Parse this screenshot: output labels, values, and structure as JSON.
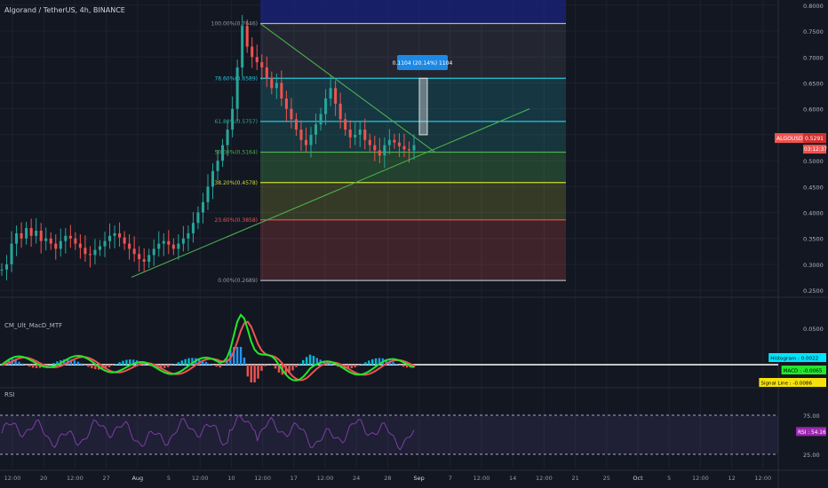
{
  "header": {
    "title": "Algorand / TetherUS, 4h, BINANCE"
  },
  "colors": {
    "bg": "#131722",
    "grid": "#1e2230",
    "up": "#26a69a",
    "down": "#ef5350",
    "trend": "#4caf50",
    "blue_band": "#1a237e",
    "badge": "#ef5350",
    "measure": "#1e88e5",
    "macd_line": "#21e82b",
    "signal_line": "#f5e20c",
    "rsi": "#7b3fa3",
    "zero_line": "#ffffff"
  },
  "chart_data": [
    {
      "type": "candlestick",
      "name": "main-price",
      "y_axis_ticks": [
        "0.8000",
        "0.7500",
        "0.7000",
        "0.6500",
        "0.6000",
        "0.5500",
        "0.5000",
        "0.4500",
        "0.4000",
        "0.3500",
        "0.3000",
        "0.2500"
      ],
      "ylim": [
        0.24,
        0.81
      ],
      "x_axis_ticks": [
        "12:00",
        "20",
        "12:00",
        "27",
        "Aug",
        "5",
        "12:00",
        "10",
        "12:00",
        "17",
        "12:00",
        "24",
        "28",
        "Sep",
        "7",
        "12:00",
        "14",
        "12:00",
        "21",
        "25",
        "Oct",
        "5",
        "12:00",
        "12",
        "12:00"
      ],
      "fib_levels": [
        {
          "label": "100.00%(0.7646)",
          "value": 0.7646,
          "line": "#b2b5be",
          "fill": "rgba(178,181,190,0.10)",
          "text": "#9598a1"
        },
        {
          "label": "78.60%(0.6589)",
          "value": 0.6589,
          "line": "#26c6da",
          "fill": "rgba(38,198,218,0.18)",
          "text": "#26c6da"
        },
        {
          "label": "61.80%(0.5757)",
          "value": 0.5757,
          "line": "#26c6da",
          "fill": "rgba(38,166,154,0.22)",
          "text": "#26a69a"
        },
        {
          "label": "50.00%(0.5164)",
          "value": 0.5164,
          "line": "#4caf50",
          "fill": "rgba(76,175,80,0.28)",
          "text": "#4caf50"
        },
        {
          "label": "38.20%(0.4578)",
          "value": 0.4578,
          "line": "#cddc39",
          "fill": "rgba(205,220,57,0.18)",
          "text": "#cddc39"
        },
        {
          "label": "23.60%(0.3858)",
          "value": 0.3858,
          "line": "#ef5350",
          "fill": "rgba(239,83,80,0.20)",
          "text": "#ef5350"
        },
        {
          "label": "0.00%(0.2689)",
          "value": 0.2689,
          "line": "#b2b5be",
          "fill": "",
          "text": "#9598a1"
        }
      ],
      "measure_label": "0.1104 (20.14%) 1104",
      "price_badge": {
        "symbol": "ALGOUSDT",
        "value": "0.5291",
        "time": "03:12:37"
      },
      "close_points": [
        [
          0.29,
          0.3,
          0.34,
          0.36,
          0.35,
          0.37,
          0.355,
          0.365,
          0.345,
          0.35,
          0.34,
          0.33,
          0.345,
          0.355,
          0.35,
          0.34,
          0.332,
          0.32,
          0.318,
          0.328,
          0.335,
          0.345,
          0.355,
          0.36,
          0.352,
          0.34,
          0.33,
          0.32,
          0.31,
          0.305,
          0.318,
          0.33,
          0.34,
          0.345,
          0.338,
          0.33,
          0.34,
          0.35,
          0.36,
          0.38,
          0.4,
          0.42,
          0.45,
          0.48,
          0.5,
          0.53,
          0.56,
          0.6,
          0.68,
          0.76,
          0.72,
          0.7,
          0.69,
          0.68,
          0.66,
          0.64,
          0.65,
          0.62,
          0.6,
          0.58,
          0.56,
          0.54,
          0.53,
          0.55,
          0.57,
          0.59,
          0.62,
          0.64,
          0.61,
          0.58,
          0.56,
          0.545,
          0.55,
          0.56,
          0.54,
          0.53,
          0.52,
          0.51,
          0.53,
          0.54,
          0.535,
          0.528,
          0.522,
          0.52,
          0.53
        ]
      ]
    },
    {
      "type": "line",
      "name": "macd",
      "label": "CM_Ult_MacD_MTF",
      "y_axis_ticks": [
        "0.0500"
      ],
      "badges": [
        {
          "text": "Histogram : 0.0022",
          "bg": "#00e5ff",
          "fg": "#000000"
        },
        {
          "text": "MACD : -0.0065",
          "bg": "#21e82b",
          "fg": "#000000"
        },
        {
          "text": "Signal Line : -0.0086",
          "bg": "#f5e20c",
          "fg": "#000000"
        }
      ]
    },
    {
      "type": "line",
      "name": "rsi",
      "label": "RSI",
      "y_axis_ticks": [
        "75.00",
        "25.00"
      ],
      "badge": {
        "text": "RSI : 54.16",
        "bg": "#9c27b0",
        "fg": "#ffffff"
      }
    }
  ]
}
